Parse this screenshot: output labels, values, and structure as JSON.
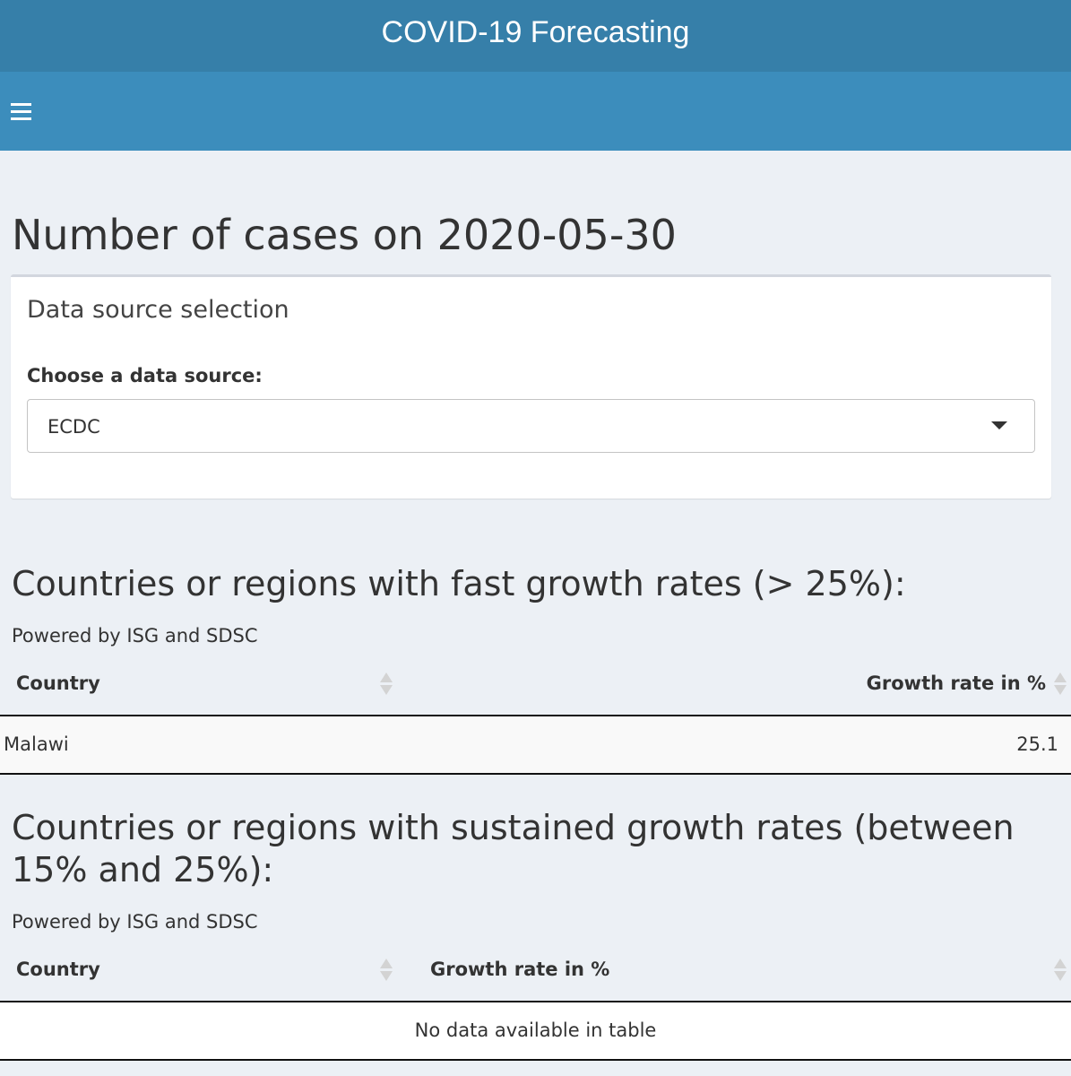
{
  "header": {
    "app_title": "COVID-19 Forecasting",
    "menu_icon": "hamburger-icon"
  },
  "main": {
    "title": "Number of cases on 2020-05-30",
    "data_source_box": {
      "title": "Data source selection",
      "label": "Choose a data source:",
      "selected": "ECDC",
      "dropdown_icon": "caret-down-icon"
    },
    "fast_growth": {
      "heading": "Countries or regions with fast growth rates (> 25%):",
      "powered_by": "Powered by ISG and SDSC",
      "columns": [
        "Country",
        "Growth rate in %"
      ],
      "rows": [
        {
          "country": "Malawi",
          "growth_rate": "25.1"
        }
      ]
    },
    "sustained_growth": {
      "heading": "Countries or regions with sustained growth rates (between 15% and 25%):",
      "powered_by": "Powered by ISG and SDSC",
      "columns": [
        "Country",
        "Growth rate in %"
      ],
      "empty_message": "No data available in table"
    }
  }
}
